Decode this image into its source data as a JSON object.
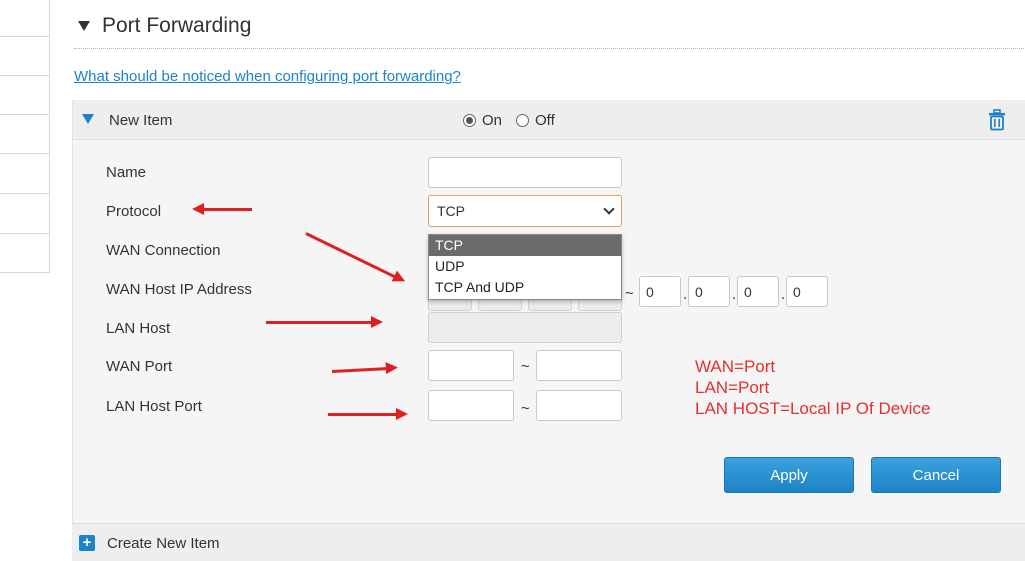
{
  "section": {
    "title": "Port Forwarding"
  },
  "help_link": "What should be noticed when configuring port forwarding?",
  "item": {
    "title": "New Item",
    "on_label": "On",
    "off_label": "Off",
    "enabled": true
  },
  "form": {
    "name_label": "Name",
    "name_value": "",
    "protocol_label": "Protocol",
    "protocol_value": "TCP",
    "protocol_options": [
      "TCP",
      "UDP",
      "TCP And UDP"
    ],
    "wan_connection_label": "WAN Connection",
    "wan_host_ip_label": "WAN Host IP Address",
    "wan_host_ip_end": [
      "0",
      "0",
      "0",
      "0"
    ],
    "lan_host_label": "LAN Host",
    "wan_port_label": "WAN Port",
    "lan_host_port_label": "LAN Host Port",
    "range_separator": "~"
  },
  "annotation": {
    "lines": [
      "WAN=Port",
      "LAN=Port",
      "LAN HOST=Local IP Of Device"
    ],
    "color": "#e02020"
  },
  "buttons": {
    "apply": "Apply",
    "cancel": "Cancel"
  },
  "footer": {
    "create_label": "Create New Item"
  },
  "colors": {
    "accent": "#1b84c9",
    "button": "#2a93d5"
  }
}
